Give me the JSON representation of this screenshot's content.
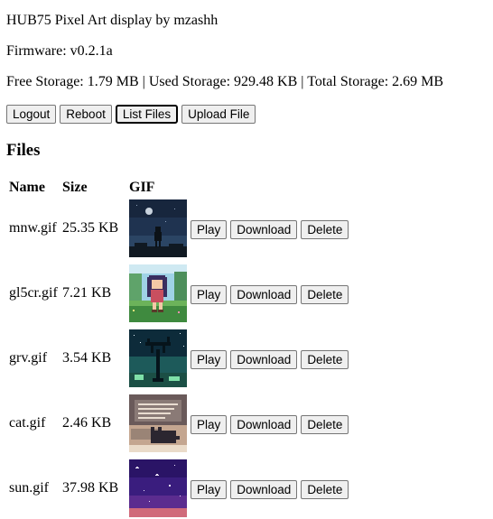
{
  "header": {
    "title": "HUB75 Pixel Art display by mzashh",
    "firmware": "Firmware: v0.2.1a",
    "storage": "Free Storage: 1.79 MB | Used Storage: 929.48 KB | Total Storage: 2.69 MB"
  },
  "toolbar": {
    "logout": "Logout",
    "reboot": "Reboot",
    "list_files": "List Files",
    "upload_file": "Upload File"
  },
  "files": {
    "heading": "Files",
    "columns": {
      "name": "Name",
      "size": "Size",
      "gif": "GIF"
    },
    "actions": {
      "play": "Play",
      "download": "Download",
      "delete": "Delete"
    },
    "rows": [
      {
        "name": "mnw.gif",
        "size": "25.35 KB",
        "thumb_icon": "night-silhouette-thumbnail"
      },
      {
        "name": "gl5cr.gif",
        "size": "7.21 KB",
        "thumb_icon": "pixel-girl-forest-thumbnail"
      },
      {
        "name": "grv.gif",
        "size": "3.54 KB",
        "thumb_icon": "spooky-tree-thumbnail"
      },
      {
        "name": "cat.gif",
        "size": "2.46 KB",
        "thumb_icon": "cat-keyboard-thumbnail"
      },
      {
        "name": "sun.gif",
        "size": "37.98 KB",
        "thumb_icon": "starry-sky-thumbnail"
      }
    ]
  }
}
